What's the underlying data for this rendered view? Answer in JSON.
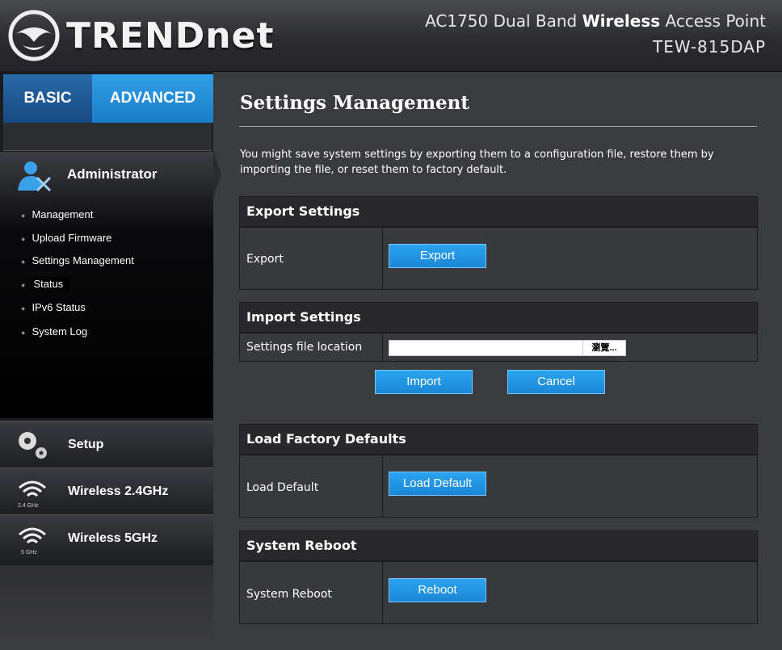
{
  "header": {
    "brand": "TRENDnet",
    "product_line_prefix": "AC1750 Dual Band ",
    "product_line_bold": "Wireless",
    "product_line_suffix": " Access Point",
    "model": "TEW-815DAP"
  },
  "sidebar": {
    "tabs": {
      "basic": "BASIC",
      "advanced": "ADVANCED"
    },
    "admin_title": "Administrator",
    "menu": [
      {
        "label": "Management"
      },
      {
        "label": "Upload Firmware"
      },
      {
        "label": "Settings Management"
      },
      {
        "label": "Status"
      },
      {
        "label": "IPv6 Status"
      },
      {
        "label": "System Log"
      }
    ],
    "sections": [
      {
        "label": "Setup",
        "icon": "gears-icon"
      },
      {
        "label": "Wireless 2.4GHz",
        "icon_caption": "2.4 GHz",
        "icon": "wifi-icon"
      },
      {
        "label": "Wireless 5GHz",
        "icon_caption": "5 GHz",
        "icon": "wifi-icon"
      }
    ]
  },
  "main": {
    "title": "Settings Management",
    "description": "You might save system settings by exporting them to a configuration file, restore them by importing the file, or reset them to factory default.",
    "export": {
      "heading": "Export Settings",
      "label": "Export",
      "button": "Export"
    },
    "import": {
      "heading": "Import Settings",
      "label": "Settings file location",
      "browse": "瀏覽...",
      "import_button": "Import",
      "cancel_button": "Cancel"
    },
    "factory": {
      "heading": "Load Factory Defaults",
      "label": "Load Default",
      "button": "Load Default"
    },
    "reboot": {
      "heading": "System Reboot",
      "label": "System Reboot",
      "button": "Reboot"
    }
  },
  "colors": {
    "accent": "#1b7cc8",
    "background": "#3a3b3f",
    "panel_header": "#29292c"
  }
}
